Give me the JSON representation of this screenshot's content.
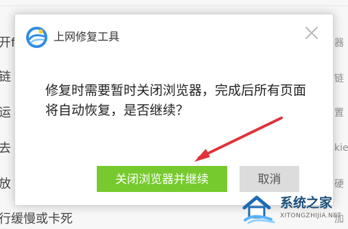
{
  "background": {
    "left_fragments": [
      "开f",
      "链",
      "运",
      "去",
      "放",
      "行缓慢或卡死"
    ],
    "right_fragments": [
      "器",
      "链",
      "置",
      "kie",
      "硬",
      "加"
    ]
  },
  "dialog": {
    "title": "上网修复工具",
    "message": "修复时需要暂时关闭浏览器，完成后所有页面将自动恢复，是否继续？",
    "primary_button": "关闭浏览器并继续",
    "secondary_button": "取消",
    "title_icon": "browser-logo-icon",
    "close_icon": "close-icon"
  },
  "watermark": {
    "site_name": "系统之家",
    "site_url": "XITONGZHIJIA.NET"
  },
  "colors": {
    "primary_button": "#76ca2d",
    "secondary_button": "#dcdcdc",
    "arrow": "#e0323a",
    "watermark_text": "#1b4f7a"
  }
}
